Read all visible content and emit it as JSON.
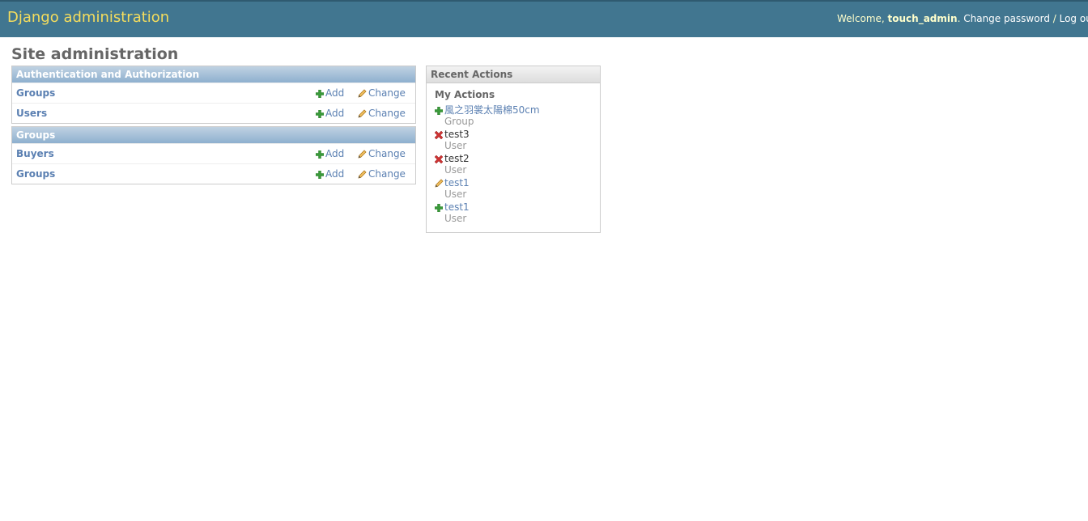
{
  "header": {
    "branding": "Django administration",
    "welcome_prefix": "Welcome, ",
    "username": "touch_admin",
    "welcome_suffix": ". ",
    "change_password": "Change password",
    "separator": " / ",
    "logout": "Log out"
  },
  "page_title": "Site administration",
  "modules": [
    {
      "caption": "Authentication and Authorization",
      "rows": [
        {
          "name": "Groups",
          "add": "Add",
          "change": "Change"
        },
        {
          "name": "Users",
          "add": "Add",
          "change": "Change"
        }
      ]
    },
    {
      "caption": "Groups",
      "rows": [
        {
          "name": "Buyers",
          "add": "Add",
          "change": "Change"
        },
        {
          "name": "Groups",
          "add": "Add",
          "change": "Change"
        }
      ]
    }
  ],
  "recent_actions": {
    "caption": "Recent Actions",
    "subtitle": "My Actions",
    "items": [
      {
        "icon": "add-icon",
        "name": "風之羽裳太陽棉50cm",
        "type": "Group",
        "link": true
      },
      {
        "icon": "delete-icon",
        "name": "test3",
        "type": "User",
        "link": false
      },
      {
        "icon": "delete-icon",
        "name": "test2",
        "type": "User",
        "link": false
      },
      {
        "icon": "change-icon",
        "name": "test1",
        "type": "User",
        "link": true
      },
      {
        "icon": "add-icon",
        "name": "test1",
        "type": "User",
        "link": true
      }
    ]
  },
  "colors": {
    "header_bg": "#417690",
    "branding": "#f5dd5d",
    "link": "#5b80b2",
    "add_green": "#3a9a3a",
    "delete_red": "#cc3333",
    "change_pencil": "#d9a441"
  }
}
